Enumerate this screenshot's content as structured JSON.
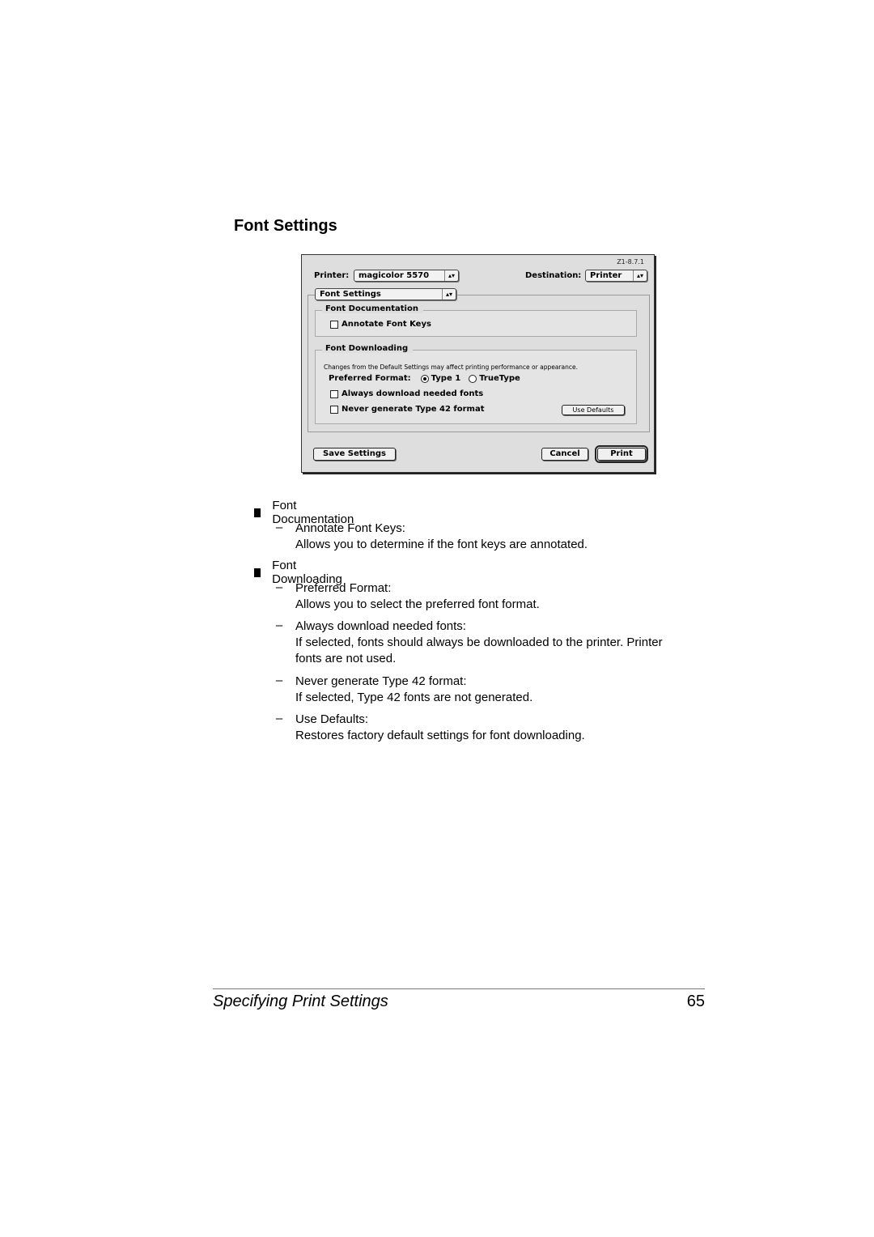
{
  "section_title": "Font Settings",
  "dialog": {
    "version": "Z1-8.7.1",
    "printer_label": "Printer:",
    "printer_value": "magicolor 5570",
    "destination_label": "Destination:",
    "destination_value": "Printer",
    "panel_select": "Font Settings",
    "font_documentation": {
      "title": "Font Documentation",
      "annotate_label": "Annotate Font Keys",
      "annotate_checked": false
    },
    "font_downloading": {
      "title": "Font Downloading",
      "note": "Changes from the Default Settings may affect printing performance or appearance.",
      "preferred_label": "Preferred Format:",
      "options": [
        "Type 1",
        "TrueType"
      ],
      "selected": "Type 1",
      "always_download_label": "Always download needed fonts",
      "never_type42_label": "Never generate Type 42 format",
      "use_defaults_label": "Use Defaults"
    },
    "save_settings_label": "Save Settings",
    "cancel_label": "Cancel",
    "print_label": "Print"
  },
  "body": {
    "bullets": [
      {
        "title": "Font Documentation",
        "items": [
          {
            "term": "Annotate Font Keys:",
            "desc": "Allows you to determine if the font keys are annotated."
          }
        ]
      },
      {
        "title": "Font Downloading",
        "items": [
          {
            "term": "Preferred Format:",
            "desc": "Allows you to select the preferred font format."
          },
          {
            "term": "Always download needed fonts:",
            "desc": "If selected, fonts should always be downloaded to the printer. Printer",
            "desc2": "fonts are not used."
          },
          {
            "term": "Never generate Type 42 format:",
            "desc": "If selected, Type 42 fonts are not generated."
          },
          {
            "term": "Use Defaults:",
            "desc": "Restores factory default settings for font downloading."
          }
        ]
      }
    ],
    "dash_glyph": "–"
  },
  "footer": {
    "title": "Specifying Print Settings",
    "page_number": "65"
  }
}
